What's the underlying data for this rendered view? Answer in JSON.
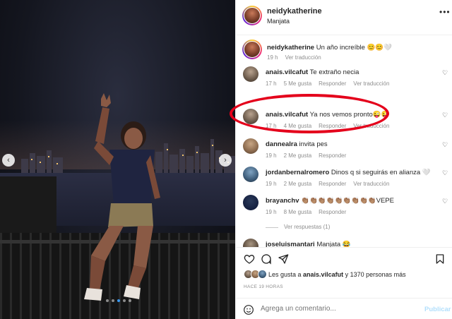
{
  "header": {
    "username": "neidykatherine",
    "location": "Manjata",
    "more": "•••"
  },
  "caption": {
    "username": "neidykatherine",
    "text": " Un año increíble 😊😊🤍",
    "time": "19 h",
    "translate": "Ver traducción"
  },
  "comments": [
    {
      "username": "anais.vilcafut",
      "text": " Te extraño necia",
      "time": "17 h",
      "likes": "5 Me gusta",
      "reply": "Responder",
      "translate": "Ver traducción"
    },
    {
      "username": "anais.vilcafut",
      "text": " Ya nos vemos pronto😜😜",
      "time": "17 h",
      "likes": "4 Me gusta",
      "reply": "Responder",
      "translate": "Ver traducción"
    },
    {
      "username": "dannealra",
      "text": " invita pes",
      "time": "19 h",
      "likes": "2 Me gusta",
      "reply": "Responder"
    },
    {
      "username": "jordanbernalromero",
      "text": " Dinos q si seguirás en alianza 🤍",
      "time": "19 h",
      "likes": "2 Me gusta",
      "reply": "Responder",
      "translate": "Ver traducción"
    },
    {
      "username": "brayanchv",
      "text": " 👏🏽👏🏽👏🏽👏🏽👏🏽👏🏽👏🏽👏🏽👏🏽VEPE",
      "time": "19 h",
      "likes": "8 Me gusta",
      "reply": "Responder"
    },
    {
      "username": "joseluismantari",
      "text": " Manjata 😂"
    }
  ],
  "view_replies": "Ver respuestas (1)",
  "likes_text_prefix": "Les gusta a ",
  "likes_user": "anais.vilcafut",
  "likes_text_suffix": " y 1370 personas más",
  "time_ago": "HACE 19 HORAS",
  "add_comment_placeholder": "Agrega un comentario...",
  "post_label": "Publicar",
  "colors": {
    "accent": "#0095f6",
    "highlight": "#e4001b",
    "post_disabled": "#b2dffc"
  }
}
